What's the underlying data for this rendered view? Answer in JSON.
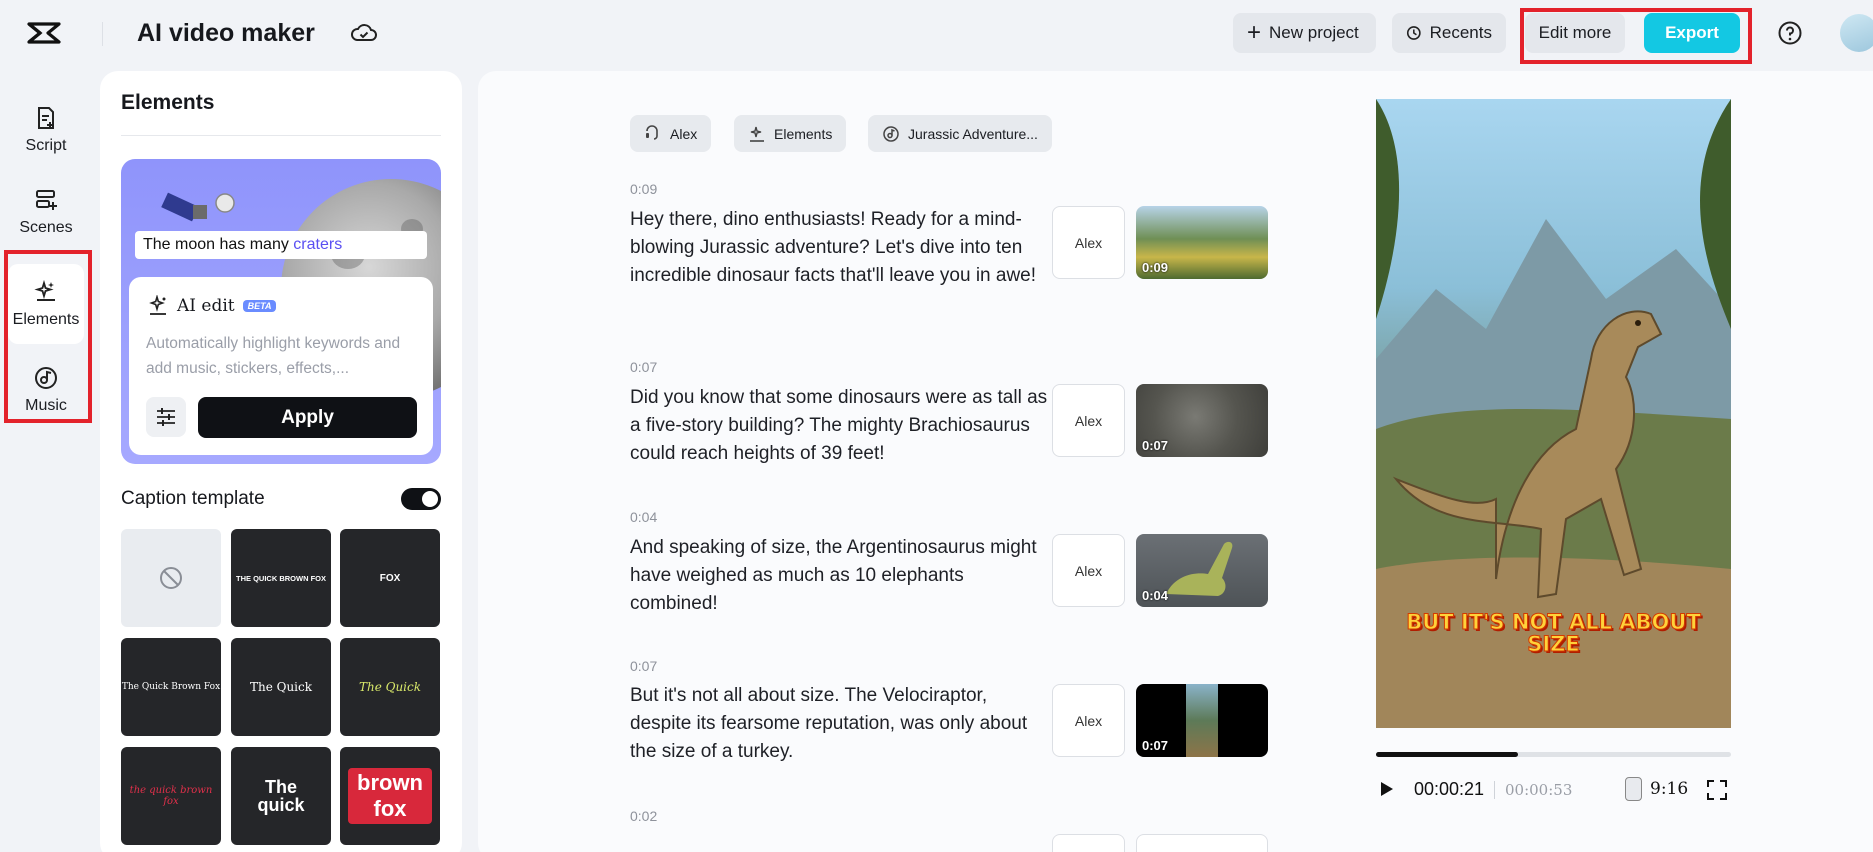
{
  "header": {
    "app_title": "AI video maker",
    "new_project_label": "New project",
    "recents_label": "Recents",
    "edit_more_label": "Edit more",
    "export_label": "Export"
  },
  "rail": {
    "items": [
      {
        "label": "Script",
        "icon": "script-icon"
      },
      {
        "label": "Scenes",
        "icon": "scenes-icon"
      },
      {
        "label": "Elements",
        "icon": "elements-icon",
        "active": true
      },
      {
        "label": "Music",
        "icon": "music-icon"
      }
    ]
  },
  "elements_panel": {
    "title": "Elements",
    "ai_card": {
      "caption_prefix": "The moon has many ",
      "caption_highlight": "craters",
      "title": "AI edit",
      "badge": "BETA",
      "description": "Automatically highlight keywords and add music, stickers, effects,...",
      "apply_label": "Apply"
    },
    "caption_template": {
      "title": "Caption template",
      "enabled": true,
      "templates": [
        {
          "text": ""
        },
        {
          "text": "THE QUICK BROWN FOX"
        },
        {
          "text": "FOX"
        },
        {
          "text": "The Quick Brown Fox"
        },
        {
          "text": "The Quick"
        },
        {
          "text": "The Quick"
        },
        {
          "text": "the quick brown fox"
        },
        {
          "text": "The quick"
        },
        {
          "text": "brown fox"
        }
      ]
    }
  },
  "script": {
    "chips": [
      {
        "label": "Alex",
        "icon": "voice-icon"
      },
      {
        "label": "Elements",
        "icon": "elements-icon"
      },
      {
        "label": "Jurassic Adventure...",
        "icon": "music-icon"
      }
    ],
    "scenes": [
      {
        "time": "0:09",
        "text": "Hey there, dino enthusiasts! Ready for a mind-blowing Jurassic adventure? Let's dive into ten incredible dinosaur facts that'll leave you in awe!",
        "voice": "Alex",
        "duration": "0:09"
      },
      {
        "time": "0:07",
        "text": "Did you know that some dinosaurs were as tall as a five-story building? The mighty Brachiosaurus could reach heights of 39 feet!",
        "voice": "Alex",
        "duration": "0:07"
      },
      {
        "time": "0:04",
        "text": "And speaking of size, the Argentinosaurus might have weighed as much as 10 elephants combined!",
        "voice": "Alex",
        "duration": "0:04"
      },
      {
        "time": "0:07",
        "text": "But it's not all about size. The Velociraptor, despite its fearsome reputation, was only about the size of a turkey.",
        "voice": "Alex",
        "duration": "0:07"
      },
      {
        "time": "0:02",
        "text": "",
        "voice": "",
        "duration": ""
      }
    ]
  },
  "preview": {
    "caption_line1": "BUT IT'S NOT ALL ABOUT",
    "caption_line2": "SIZE",
    "current_time": "00:00:21",
    "total_time": "00:00:53",
    "aspect_ratio": "9:16",
    "progress": 0.4
  },
  "colors": {
    "accent": "#13c8e3",
    "highlight_box": "#e3222b",
    "ai_card_bg": "#a6a9ff"
  }
}
